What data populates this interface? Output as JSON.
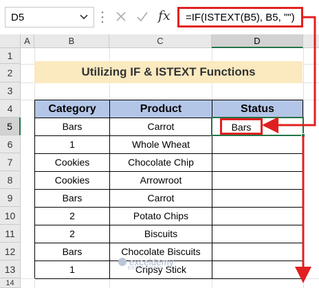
{
  "formula_bar": {
    "name_box": "D5",
    "fx_label": "fx",
    "formula": "=IF(ISTEXT(B5), B5, \"\")"
  },
  "columns": [
    "A",
    "B",
    "C",
    "D"
  ],
  "rows": [
    "1",
    "2",
    "3",
    "4",
    "5",
    "6",
    "7",
    "8",
    "9",
    "10",
    "11",
    "12",
    "13",
    "14"
  ],
  "title": "Utilizing IF & ISTEXT Functions",
  "table": {
    "headers": [
      "Category",
      "Product",
      "Status"
    ],
    "rows": [
      [
        "Bars",
        "Carrot",
        "Bars"
      ],
      [
        "1",
        "Whole Wheat",
        ""
      ],
      [
        "Cookies",
        "Chocolate Chip",
        ""
      ],
      [
        "Cookies",
        "Arrowroot",
        ""
      ],
      [
        "Bars",
        "Carrot",
        ""
      ],
      [
        "2",
        "Potato Chips",
        ""
      ],
      [
        "2",
        "Biscuits",
        ""
      ],
      [
        "Bars",
        "Chocolate Biscuits",
        ""
      ],
      [
        "1",
        "Cripsy Stick",
        ""
      ]
    ]
  },
  "watermark": {
    "brand": "exceldemy",
    "tagline": "EXCEL · DATA · BI"
  },
  "colors": {
    "annotation": "#e02020",
    "selection": "#217346",
    "table_header": "#b4c6e7",
    "title_fill": "#fbe9c0"
  }
}
